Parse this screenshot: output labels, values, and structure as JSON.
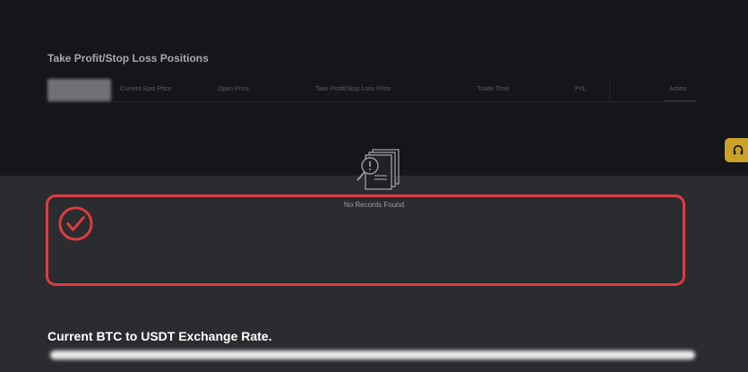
{
  "section": {
    "title": "Take Profit/Stop Loss Positions",
    "columns": [
      "Current Spot Price",
      "Open Price",
      "Take Profit/Stop Loss Price",
      "Trade Time",
      "PnL",
      "Action"
    ]
  },
  "empty_state": {
    "message": "No Records Found",
    "icon": "document-search-icon"
  },
  "exchange": {
    "title": "Current BTC to USDT Exchange Rate."
  },
  "colors": {
    "highlight": "#e23b3f",
    "support_button": "#c9a227",
    "panel_bg": "#15161a",
    "page_bg": "#2b2c30"
  }
}
